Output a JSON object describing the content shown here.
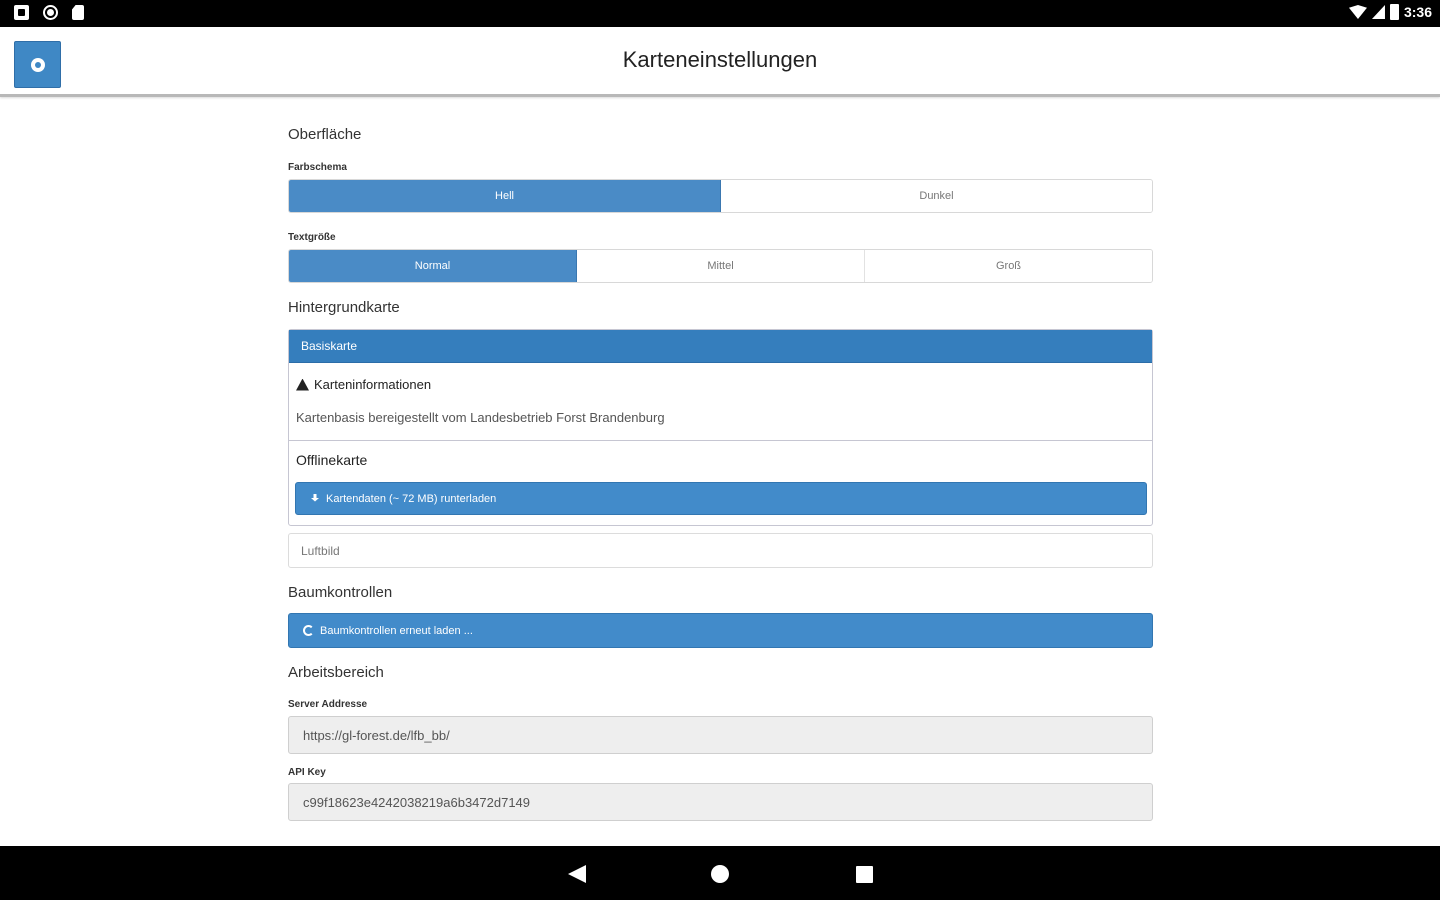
{
  "status_bar": {
    "time": "3:36",
    "icons": [
      "notification-square-icon",
      "sync-circle-icon",
      "sd-card-icon",
      "wifi-icon",
      "signal-icon",
      "battery-icon"
    ]
  },
  "header": {
    "title": "Karteneinstellungen",
    "menu_icon": "gear-icon"
  },
  "surface": {
    "title": "Oberfläche",
    "color_scheme": {
      "label": "Farbschema",
      "options": [
        "Hell",
        "Dunkel"
      ],
      "selected": "Hell"
    },
    "text_size": {
      "label": "Textgröße",
      "options": [
        "Normal",
        "Mittel",
        "Groß"
      ],
      "selected": "Normal"
    }
  },
  "background_map": {
    "title": "Hintergrundkarte",
    "base_map": {
      "label": "Basiskarte",
      "info_title": "Karteninformationen",
      "info_text": "Kartenbasis bereigestellt vom Landesbetrieb Forst Brandenburg",
      "offline_title": "Offlinekarte",
      "download_label": "Kartendaten (~ 72 MB) runterladen"
    },
    "aerial_label": "Luftbild"
  },
  "tree_controls": {
    "title": "Baumkontrollen",
    "reload_label": "Baumkontrollen erneut laden ..."
  },
  "workspace": {
    "title": "Arbeitsbereich",
    "server_label": "Server Addresse",
    "server_value": "https://gl-forest.de/lfb_bb/",
    "api_label": "API Key",
    "api_value": "c99f18623e4242038219a6b3472d7149"
  },
  "colors": {
    "primary": "#428bca",
    "panel_header": "#357ebd",
    "input_bg": "#eeeeee"
  }
}
